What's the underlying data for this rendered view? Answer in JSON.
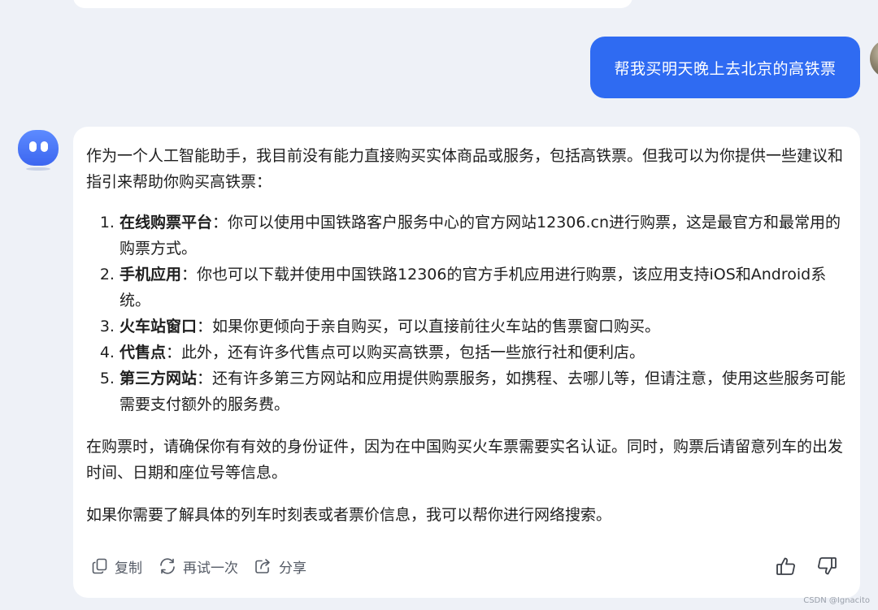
{
  "user_message": "帮我买明天晚上去北京的高铁票",
  "assistant": {
    "intro": "作为一个人工智能助手，我目前没有能力直接购买实体商品或服务，包括高铁票。但我可以为你提供一些建议和指引来帮助你购买高铁票：",
    "options": [
      {
        "title": "在线购票平台",
        "text": "：你可以使用中国铁路客户服务中心的官方网站12306.cn进行购票，这是最官方和最常用的购票方式。"
      },
      {
        "title": "手机应用",
        "text": "：你也可以下载并使用中国铁路12306的官方手机应用进行购票，该应用支持iOS和Android系统。"
      },
      {
        "title": "火车站窗口",
        "text": "：如果你更倾向于亲自购买，可以直接前往火车站的售票窗口购买。"
      },
      {
        "title": "代售点",
        "text": "：此外，还有许多代售点可以购买高铁票，包括一些旅行社和便利店。"
      },
      {
        "title": "第三方网站",
        "text": "：还有许多第三方网站和应用提供购票服务，如携程、去哪儿等，但请注意，使用这些服务可能需要支付额外的服务费。"
      }
    ],
    "note": "在购票时，请确保你有有效的身份证件，因为在中国购买火车票需要实名认证。同时，购票后请留意列车的出发时间、日期和座位号等信息。",
    "closing": "如果你需要了解具体的列车时刻表或者票价信息，我可以帮你进行网络搜索。"
  },
  "actions": {
    "copy": {
      "label": "复制",
      "icon": "copy-icon"
    },
    "retry": {
      "label": "再试一次",
      "icon": "refresh-icon"
    },
    "share": {
      "label": "分享",
      "icon": "share-icon"
    },
    "like": {
      "icon": "thumbs-up-icon"
    },
    "dislike": {
      "icon": "thumbs-down-icon"
    }
  },
  "watermark": "CSDN @Ignacito",
  "colors": {
    "background": "#eef1f7",
    "user_bubble": "#2f6bf2",
    "card": "#ffffff",
    "text": "#1f1f1f",
    "action_text": "#555b66"
  }
}
